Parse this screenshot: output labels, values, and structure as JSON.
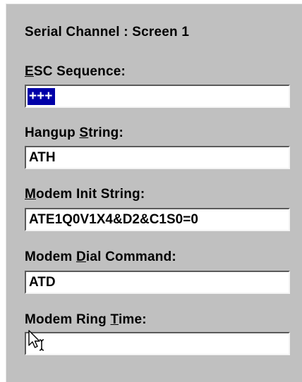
{
  "dialog": {
    "title": "Serial Channel : Screen 1"
  },
  "fields": [
    {
      "label_accel": "E",
      "label_rest": "SC Sequence:",
      "value": "+++",
      "selected": true
    },
    {
      "label_pre": "Hangup ",
      "label_accel": "S",
      "label_rest": "tring:",
      "value": "ATH"
    },
    {
      "label_accel": "M",
      "label_rest": "odem Init String:",
      "value": "ATE1Q0V1X4&D2&C1S0=0"
    },
    {
      "label_pre": "Modem ",
      "label_accel": "D",
      "label_rest": "ial Command:",
      "value": "ATD"
    },
    {
      "label_pre": "Modem Ring ",
      "label_accel": "T",
      "label_rest": "ime:",
      "value": ""
    }
  ],
  "cursor": {
    "icon": "text-beam-arrow-cursor"
  }
}
